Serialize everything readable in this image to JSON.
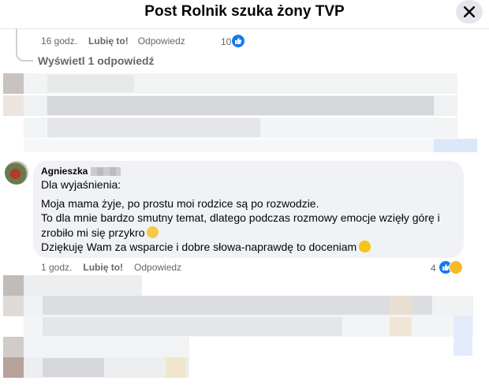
{
  "header": {
    "title": "Post Rolnik szuka żony TVP",
    "close_icon": "close-icon"
  },
  "first_comment": {
    "time": "16 godz.",
    "like_label": "Lubię to!",
    "reply_label": "Odpowiedz",
    "reaction_count": "10",
    "view_replies": "Wyświetl 1 odpowiedź"
  },
  "main_comment": {
    "author": "Agnieszka",
    "lines": [
      "Dla wyjaśnienia:",
      "Moja mama żyje, po prostu moi rodzice są po rozwodzie.",
      "To dla mnie bardzo smutny temat, dlatego podczas rozmowy emocje wzięły górę i",
      "zrobiło mi się przykro",
      "Dziękuję Wam za wsparcie i dobre słowa-naprawdę to doceniam"
    ],
    "time": "1 godz.",
    "like_label": "Lubię to!",
    "reply_label": "Odpowiedz",
    "reaction_count": "4",
    "sad_emoji": "sad-face-emoji",
    "heart_emoji": "yellow-heart-emoji"
  },
  "colors": {
    "accent": "#1877f2",
    "bubble": "#f0f2f5",
    "muted_text": "#65676b"
  }
}
